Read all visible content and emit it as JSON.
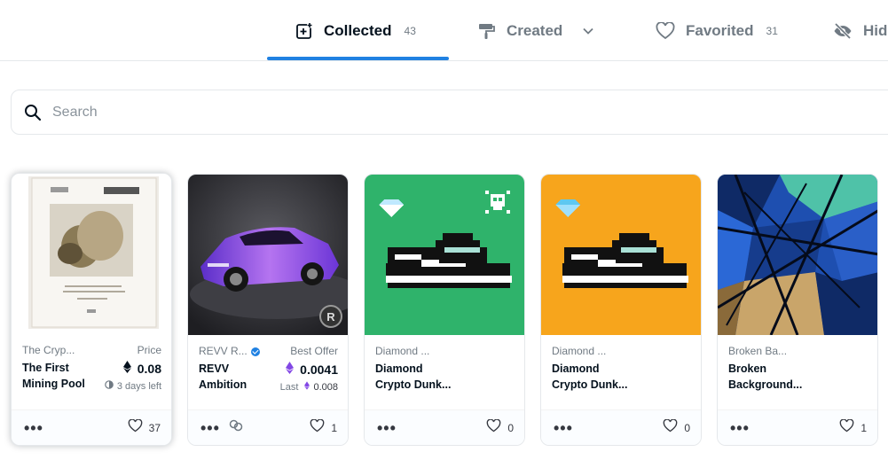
{
  "tabs": [
    {
      "label": "Collected",
      "count": "43",
      "icon": "image-plus-icon",
      "active": true
    },
    {
      "label": "Created",
      "count": "",
      "icon": "paint-roller-icon",
      "active": false
    },
    {
      "label": "Favorited",
      "count": "31",
      "icon": "heart-icon",
      "active": false
    },
    {
      "label": "Hid",
      "count": "",
      "icon": "eye-off-icon",
      "active": false
    }
  ],
  "accent_color": "#2081e2",
  "search": {
    "placeholder": "Search",
    "value": ""
  },
  "cards": [
    {
      "collection": "The Cryp...",
      "name_line1": "The First",
      "name_line2": "Mining Pool",
      "price_label": "Price",
      "price": "0.08",
      "price_currency": "ETH",
      "sub": "3 days left",
      "sub_icon": "clock-icon",
      "favorites": "37",
      "bg": "#ffffff"
    },
    {
      "collection": "REVV R...",
      "verified": true,
      "name_line1": "REVV",
      "name_line2": "Ambition",
      "price_label": "Best Offer",
      "price": "0.0041",
      "price_currency": "WETH",
      "sub_label": "Last",
      "sub": "0.008",
      "favorites": "1",
      "bg": "#2b2b2f"
    },
    {
      "collection": "Diamond ...",
      "name_line1": "Diamond",
      "name_line2": "Crypto Dunk...",
      "favorites": "0",
      "bg": "#2fb36b"
    },
    {
      "collection": "Diamond ...",
      "name_line1": "Diamond",
      "name_line2": "Crypto Dunk...",
      "favorites": "0",
      "bg": "#f7a51c"
    },
    {
      "collection": "Broken Ba...",
      "name_line1": "Broken",
      "name_line2": "Background...",
      "favorites": "1",
      "bg": "#1e4fb0"
    }
  ]
}
